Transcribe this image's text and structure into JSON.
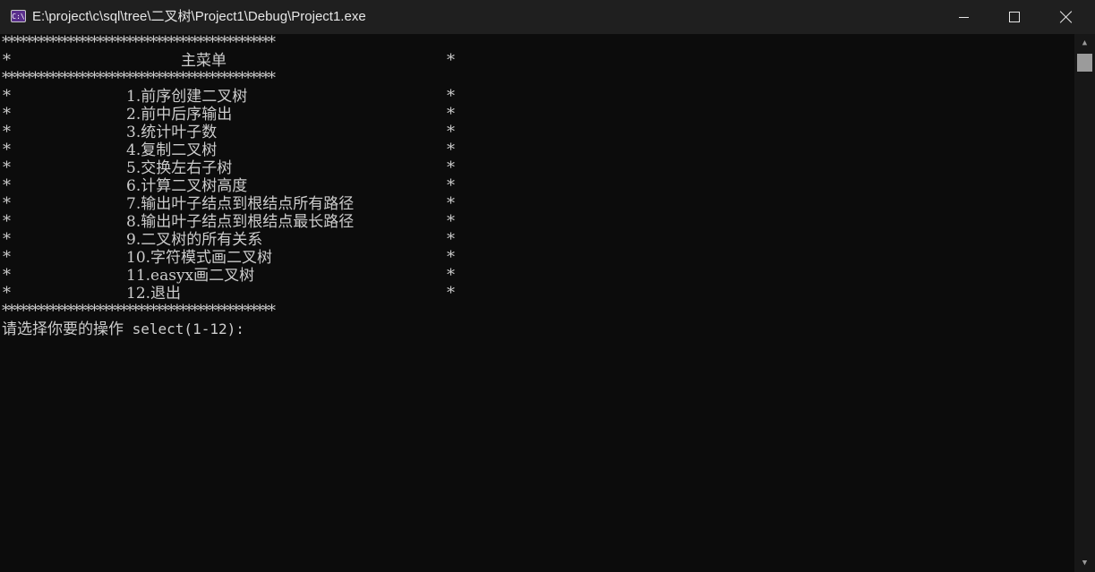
{
  "window": {
    "title": "E:\\project\\c\\sql\\tree\\二叉树\\Project1\\Debug\\Project1.exe",
    "icon": "console-app-icon",
    "icon_label": "C:\\"
  },
  "titlebar_buttons": {
    "minimize": "minimize-icon",
    "maximize": "maximize-icon",
    "close": "close-icon"
  },
  "console": {
    "border": "**********************************************",
    "star": "*",
    "header_title": "主菜单",
    "menu_items": [
      "1.前序创建二叉树",
      "2.前中后序输出",
      "3.统计叶子数",
      "4.复制二叉树",
      "5.交换左右子树",
      "6.计算二叉树高度",
      "7.输出叶子结点到根结点所有路径",
      "8.输出叶子结点到根结点最长路径",
      "9.二叉树的所有关系",
      "10.字符模式画二叉树",
      "11.easyx画二叉树",
      "12.退出"
    ],
    "prompt_cn": "请选择你要的操作",
    "prompt_en": " select(1-12):"
  },
  "scrollbar": {
    "up_arrow": "▲",
    "down_arrow": "▼"
  },
  "colors": {
    "console_bg": "#0c0c0c",
    "console_text": "#cccccc",
    "titlebar_bg": "#1f1f1f"
  }
}
